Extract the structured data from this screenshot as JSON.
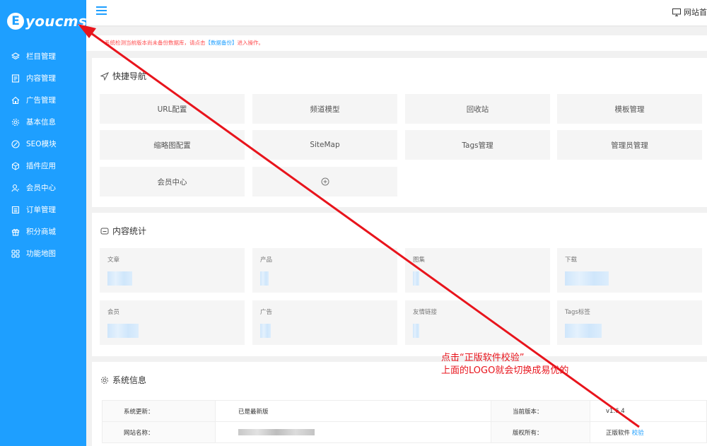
{
  "sidebar": {
    "logo": {
      "mark": "E",
      "text": "youcms"
    },
    "items": [
      {
        "label": "栏目管理",
        "icon": "layers-icon"
      },
      {
        "label": "内容管理",
        "icon": "document-icon"
      },
      {
        "label": "广告管理",
        "icon": "home-icon"
      },
      {
        "label": "基本信息",
        "icon": "gear-icon"
      },
      {
        "label": "SEO模块",
        "icon": "compass-icon"
      },
      {
        "label": "插件应用",
        "icon": "cube-icon"
      },
      {
        "label": "会员中心",
        "icon": "user-icon"
      },
      {
        "label": "订单管理",
        "icon": "list-icon"
      },
      {
        "label": "积分商城",
        "icon": "gift-icon"
      },
      {
        "label": "功能地图",
        "icon": "grid-icon"
      }
    ]
  },
  "header": {
    "site_home_label": "网站首"
  },
  "notice": {
    "text_before": "系统检测当前版本尚未备份数据库，请点击",
    "link": "【数据备份】",
    "text_after": "进入操作。"
  },
  "quick_nav": {
    "title": "快捷导航",
    "items": [
      "URL配置",
      "频道模型",
      "回收站",
      "模板管理",
      "缩略图配置",
      "SiteMap",
      "Tags管理",
      "管理员管理",
      "会员中心"
    ],
    "add_icon": "plus-circle-icon"
  },
  "stats": {
    "title": "内容统计",
    "items": [
      "文章",
      "产品",
      "图集",
      "下载",
      "会员",
      "广告",
      "友情链接",
      "Tags标签"
    ]
  },
  "system_info": {
    "title": "系统信息",
    "rows": [
      {
        "label": "系统更新：",
        "value": "已是最新版",
        "label2": "当前版本：",
        "value2": "v1.6.4"
      },
      {
        "label": "网站名称：",
        "value": "",
        "label2": "版权所有：",
        "value2": "正版软件",
        "link": "校验"
      }
    ]
  },
  "annotation": {
    "line1": "点击“正版软件校验”",
    "line2": "上面的LOGO就会切换成易优的"
  },
  "colors": {
    "accent": "#1e9fff",
    "annotation": "#e8141c",
    "notice": "#ff4d4f"
  }
}
